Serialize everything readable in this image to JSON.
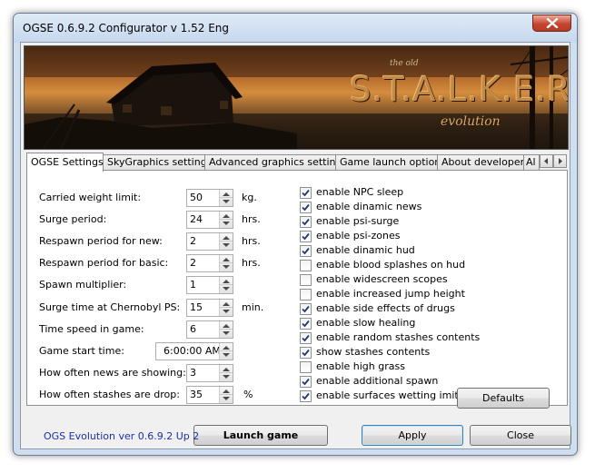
{
  "window": {
    "title": "OGSE 0.6.9.2 Configurator  v 1.52 Eng"
  },
  "banner": {
    "logo_text": "S.T.A.L.K.E.R.",
    "logo_sub": "evolution",
    "logo_small": "the old"
  },
  "tabs": [
    {
      "label": "OGSE Settings",
      "active": true
    },
    {
      "label": "SkyGraphics settings"
    },
    {
      "label": "Advanced graphics settings"
    },
    {
      "label": "Game launch options"
    },
    {
      "label": "About developers"
    },
    {
      "label": "Al"
    }
  ],
  "settings": [
    {
      "label": "Carried weight limit:",
      "value": "50",
      "unit": "kg."
    },
    {
      "label": "Surge period:",
      "value": "24",
      "unit": "hrs."
    },
    {
      "label": "Respawn period for new:",
      "value": "2",
      "unit": "hrs."
    },
    {
      "label": "Respawn period for basic:",
      "value": "2",
      "unit": "hrs."
    },
    {
      "label": "Spawn multiplier:",
      "value": "1",
      "unit": ""
    },
    {
      "label": "Surge time at Chernobyl PS:",
      "value": "15",
      "unit": "min."
    },
    {
      "label": "Time speed in game:",
      "value": "6",
      "unit": ""
    },
    {
      "label": "Game start time:",
      "value": "6:00:00 AM",
      "unit": ""
    },
    {
      "label": "How often news are showing:",
      "value": "3",
      "unit": ""
    },
    {
      "label": "How often stashes are drop:",
      "value": "35",
      "unit": "%"
    }
  ],
  "options": [
    {
      "label": "enable NPC sleep",
      "checked": true
    },
    {
      "label": "enable dinamic news",
      "checked": true
    },
    {
      "label": "enable psi-surge",
      "checked": true
    },
    {
      "label": "enable psi-zones",
      "checked": true
    },
    {
      "label": "enable dinamic hud",
      "checked": true
    },
    {
      "label": "enable blood splashes on hud",
      "checked": false
    },
    {
      "label": "enable widescreen scopes",
      "checked": false
    },
    {
      "label": "enable increased jump height",
      "checked": false
    },
    {
      "label": "enable side effects of drugs",
      "checked": true
    },
    {
      "label": "enable slow healing",
      "checked": true
    },
    {
      "label": "enable random stashes contents",
      "checked": true
    },
    {
      "label": "show stashes contents",
      "checked": true
    },
    {
      "label": "enable high grass",
      "checked": false
    },
    {
      "label": "enable additional spawn",
      "checked": true
    },
    {
      "label": "enable surfaces wetting imitation",
      "checked": true
    }
  ],
  "buttons": {
    "defaults": "Defaults",
    "launch": "Launch game",
    "apply": "Apply",
    "close": "Close"
  },
  "footer": {
    "version": "OGS Evolution ver 0.6.9.2 Up 2"
  }
}
